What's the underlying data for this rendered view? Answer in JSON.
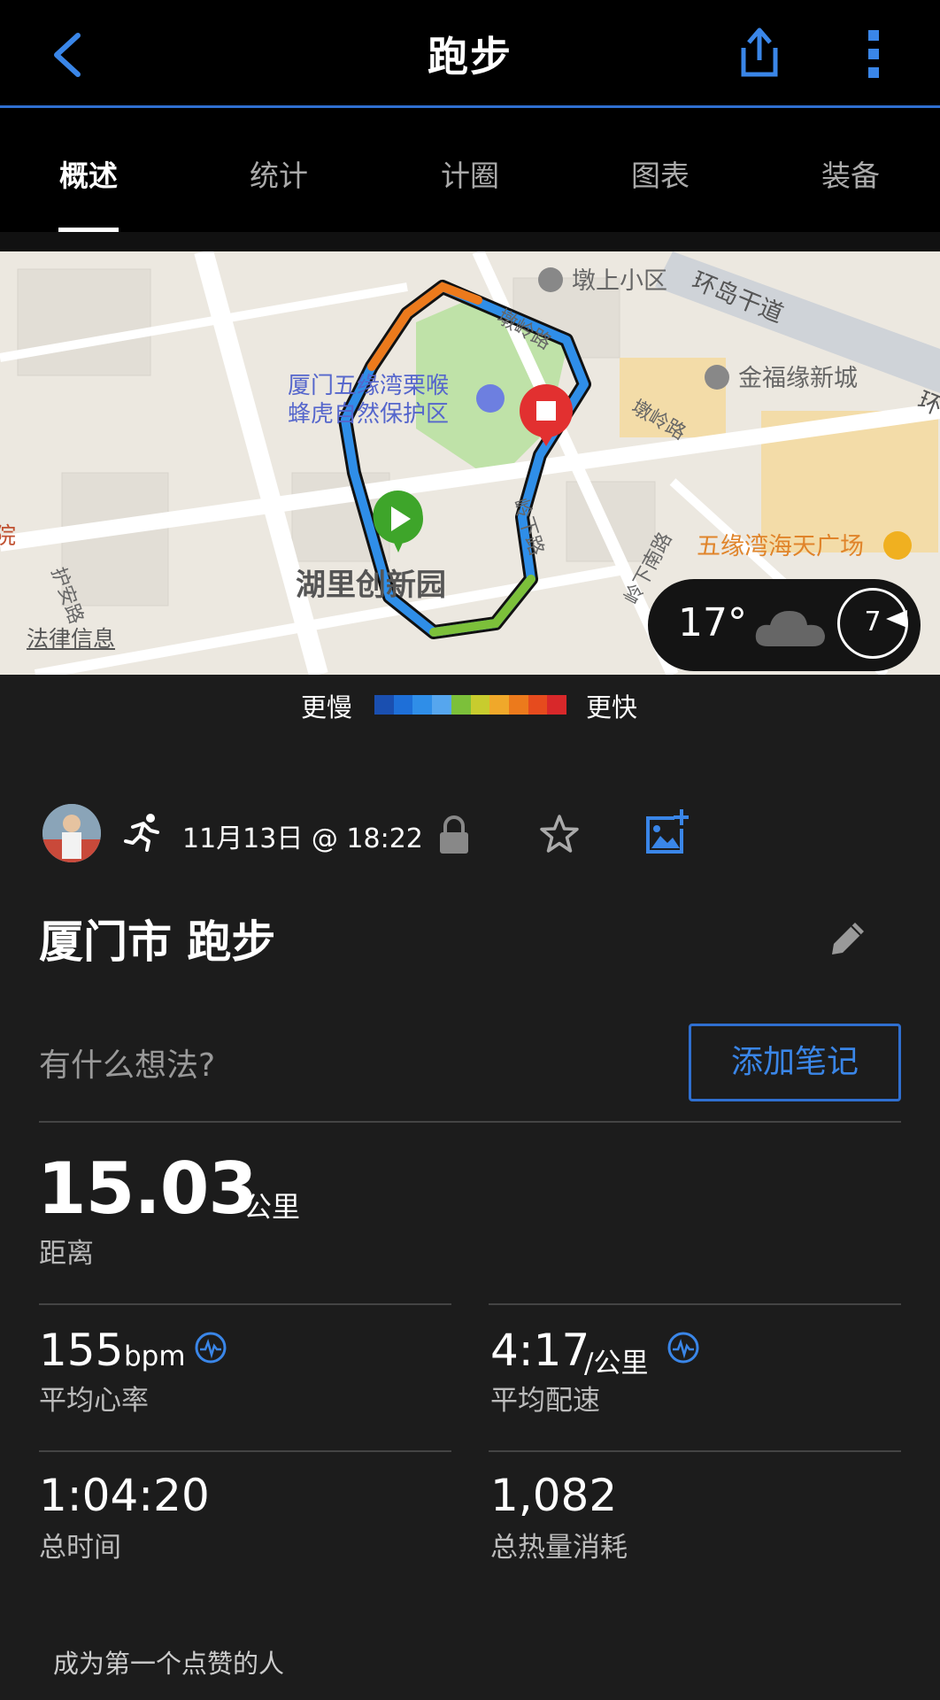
{
  "header": {
    "title": "跑步"
  },
  "tabs": [
    {
      "label": "概述"
    },
    {
      "label": "统计"
    },
    {
      "label": "计圈"
    },
    {
      "label": "图表"
    },
    {
      "label": "装备"
    }
  ],
  "map": {
    "labels": {
      "dunshang": "墩上小区",
      "huandao": "环岛干道",
      "huandao2": "环",
      "reserve1": "厦门五缘湾栗喉",
      "reserve2": "蜂虎自然保护区",
      "jinfu": "金福缘新城",
      "dunling1": "墩岭路",
      "dunling2": "墩岭路",
      "lingxia": "岭下路",
      "lingxianan": "岭下南路",
      "haitian": "五缘湾海天广场",
      "huli": "湖里创新园",
      "huan": "护安路",
      "left_edge": "院"
    },
    "legal": "法律信息",
    "weather": {
      "temp": "17°",
      "wind": "7"
    }
  },
  "legend": {
    "slower": "更慢",
    "faster": "更快",
    "colors": [
      "#1a4fb0",
      "#1e6fd8",
      "#2f8ee8",
      "#56a6ee",
      "#7cc03a",
      "#c8cc2e",
      "#f0a82a",
      "#ec7a1c",
      "#e64b1e",
      "#d8282a"
    ]
  },
  "activity": {
    "date": "11月13日 @ 18:22",
    "name": "厦门市 跑步",
    "thought_placeholder": "有什么想法?",
    "add_note": "添加笔记"
  },
  "stats": {
    "distance": {
      "value": "15.03",
      "unit": "公里",
      "label": "距离"
    },
    "avg_hr": {
      "value": "155",
      "unit": "bpm",
      "label": "平均心率"
    },
    "avg_pace": {
      "value": "4:17",
      "unit": "/公里",
      "label": "平均配速"
    },
    "total_time": {
      "value": "1:04:20",
      "label": "总时间"
    },
    "calories": {
      "value": "1,082",
      "label": "总热量消耗"
    }
  },
  "footer": {
    "like_prompt": "成为第一个点赞的人"
  }
}
